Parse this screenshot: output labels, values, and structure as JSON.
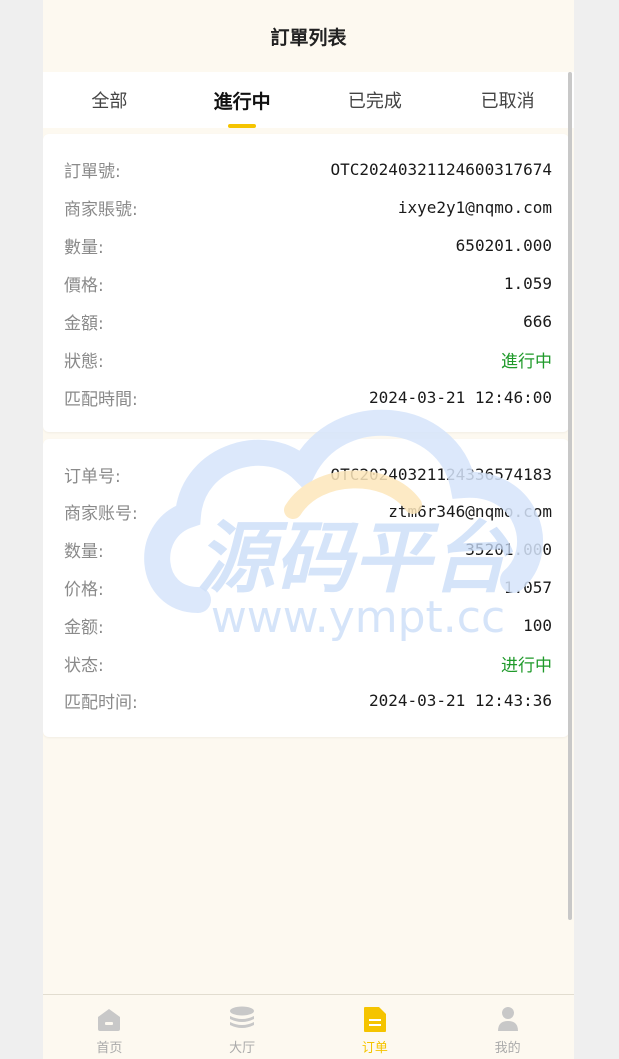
{
  "header": {
    "title": "訂單列表"
  },
  "tabs": [
    {
      "label": "全部"
    },
    {
      "label": "進行中"
    },
    {
      "label": "已完成"
    },
    {
      "label": "已取消"
    }
  ],
  "orders": [
    {
      "rows": [
        {
          "label": "訂單號:",
          "value": "OTC20240321124600317674"
        },
        {
          "label": "商家賬號:",
          "value": "ixye2y1@nqmo.com"
        },
        {
          "label": "數量:",
          "value": "650201.000"
        },
        {
          "label": "價格:",
          "value": "1.059"
        },
        {
          "label": "金額:",
          "value": "666"
        },
        {
          "label": "狀態:",
          "value": "進行中"
        },
        {
          "label": "匹配時間:",
          "value": "2024-03-21 12:46:00"
        }
      ]
    },
    {
      "rows": [
        {
          "label": "订单号:",
          "value": "OTC20240321124336574183"
        },
        {
          "label": "商家账号:",
          "value": "ztm6r346@nqmo.com"
        },
        {
          "label": "数量:",
          "value": "35201.000"
        },
        {
          "label": "价格:",
          "value": "1.057"
        },
        {
          "label": "金额:",
          "value": "100"
        },
        {
          "label": "状态:",
          "value": "进行中"
        },
        {
          "label": "匹配时间:",
          "value": "2024-03-21 12:43:36"
        }
      ]
    }
  ],
  "watermark": {
    "title": "源码平台",
    "url": "www.ympt.cc"
  },
  "tabbar": [
    {
      "label": "首页",
      "icon": "home-icon"
    },
    {
      "label": "大厅",
      "icon": "coins-icon"
    },
    {
      "label": "订单",
      "icon": "document-icon"
    },
    {
      "label": "我的",
      "icon": "user-icon"
    }
  ],
  "colors": {
    "accent": "#f5c400",
    "status_green": "#1f9a2a"
  }
}
